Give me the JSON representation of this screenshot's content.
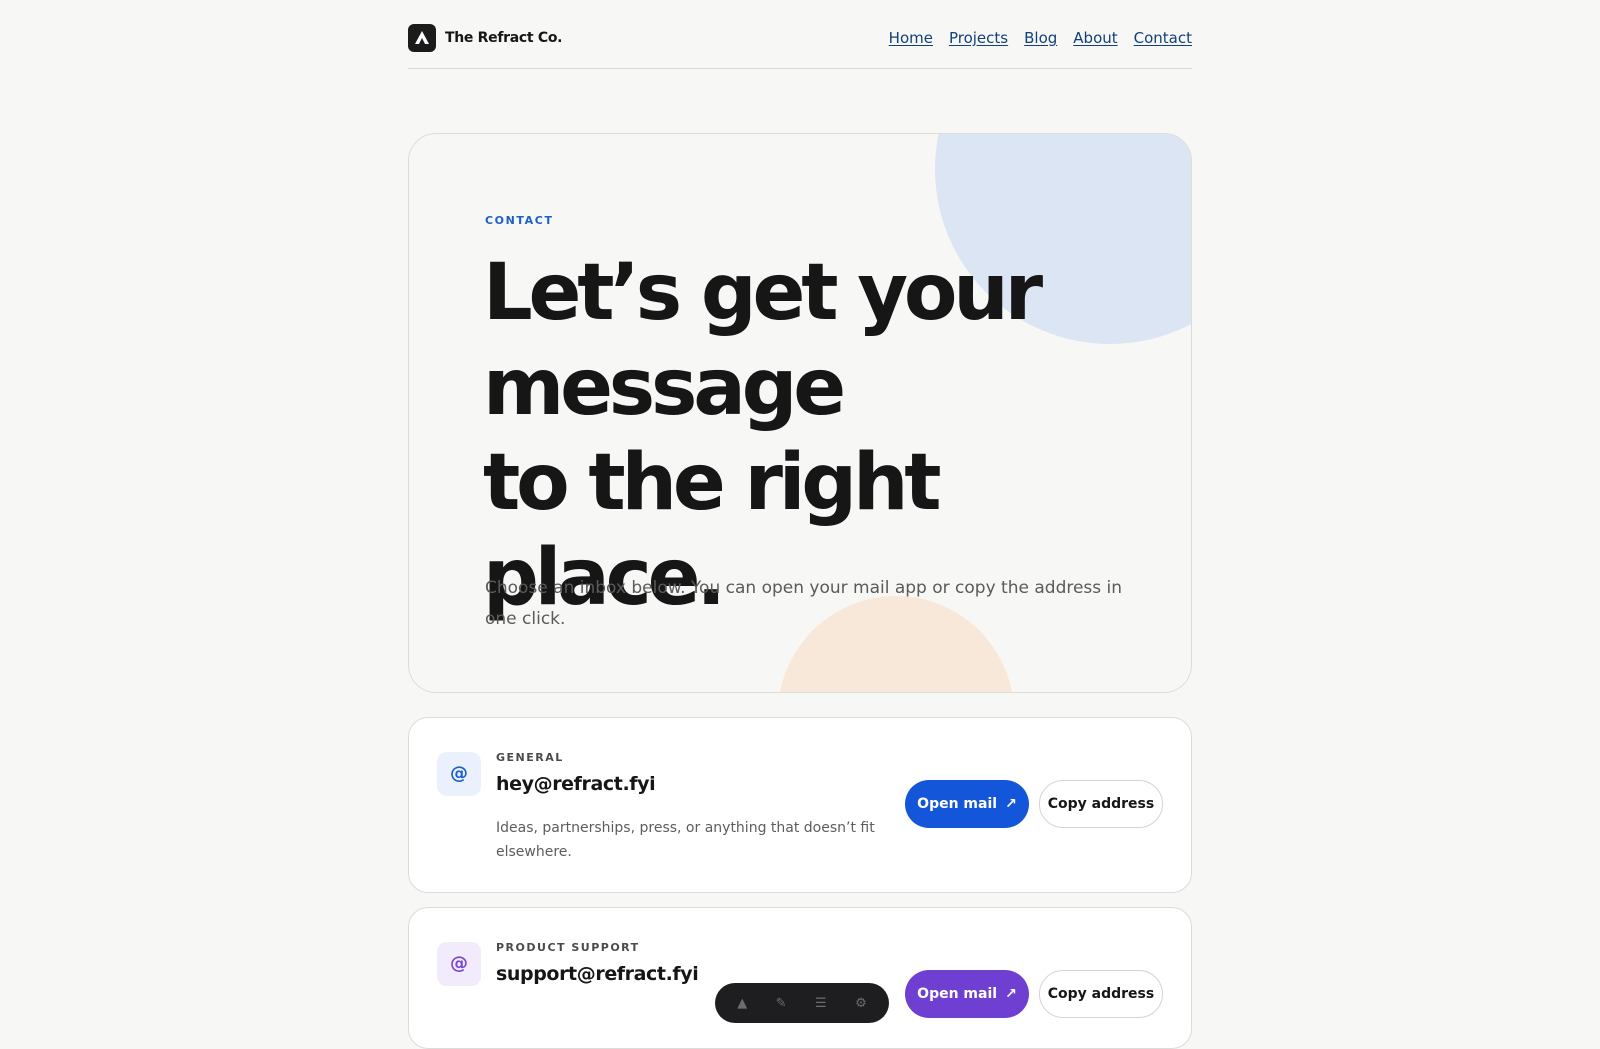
{
  "brand": {
    "name": "The Refract Co."
  },
  "nav": [
    "Home",
    "Projects",
    "Blog",
    "About",
    "Contact"
  ],
  "hero": {
    "eyebrow": "CONTACT",
    "headline_lines": [
      "Let’s get your",
      "message",
      "to the right place."
    ],
    "subtitle": "Choose an inbox below. You can open your mail app or copy the address in one click."
  },
  "cards": [
    {
      "icon": "at-icon",
      "label": "GENERAL",
      "email": "hey@refract.fyi",
      "description": "Ideas, partnerships, press, or anything that doesn’t fit elsewhere.",
      "open_label": "Open mail",
      "open_arrow": "↗",
      "copy_label": "Copy address",
      "accent": "#1456d9"
    },
    {
      "icon": "at-icon",
      "label": "PRODUCT SUPPORT",
      "email": "support@refract.fyi",
      "open_label": "Open mail",
      "open_arrow": "↗",
      "copy_label": "Copy address",
      "accent": "#6e3fd1"
    }
  ],
  "colors": {
    "accent_blue": "#1456d9",
    "accent_purple": "#6e3fd1",
    "eyebrow_blue": "#1c5fc7",
    "nav_link": "#12407a",
    "background": "#f7f7f5"
  }
}
